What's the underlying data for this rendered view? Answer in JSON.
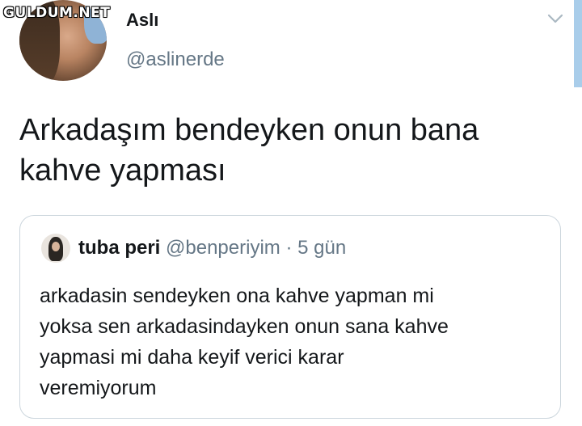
{
  "watermark": "GULDUM.NET",
  "tweet": {
    "display_name": "Aslı",
    "handle": "@aslinerde",
    "text_lines": [
      "Arkadaşım bendeyken onun bana",
      "kahve yapması"
    ]
  },
  "icons": {
    "menu": "chevron-down-icon"
  },
  "quote": {
    "display_name": "tuba peri",
    "handle": "@benperiyim",
    "separator": "·",
    "time": "5 gün",
    "text_lines": [
      "arkadasin sendeyken ona kahve yapman mi",
      "yoksa sen arkadasindayken onun sana kahve",
      "yapmasi mi daha keyif verici karar",
      "veremiyorum"
    ]
  },
  "colors": {
    "text": "#14171a",
    "muted": "#657786",
    "border": "#ccd6dd",
    "accent": "#a9cdea"
  }
}
